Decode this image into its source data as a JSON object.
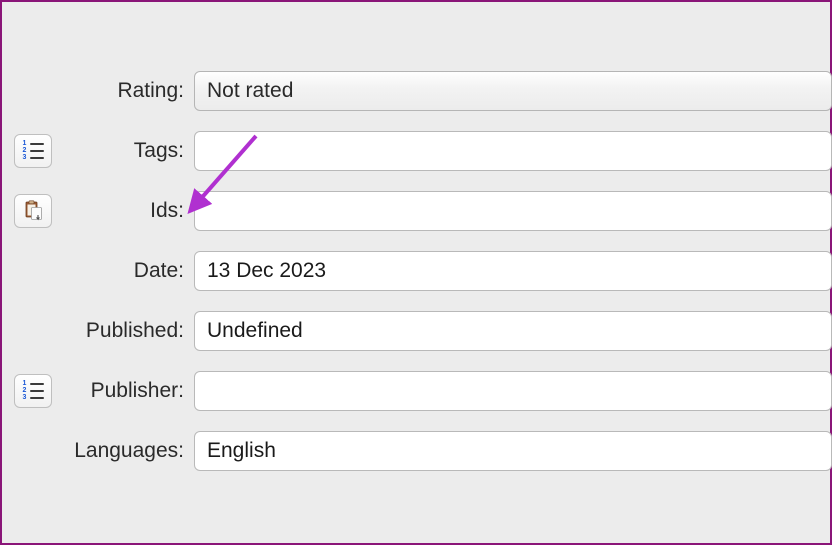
{
  "fields": {
    "rating": {
      "label": "Rating:",
      "value": "Not rated"
    },
    "tags": {
      "label": "Tags:",
      "value": ""
    },
    "ids": {
      "label": "Ids:",
      "value": ""
    },
    "date": {
      "label": "Date:",
      "value": "13 Dec 2023"
    },
    "published": {
      "label": "Published:",
      "value": "Undefined"
    },
    "publisher": {
      "label": "Publisher:",
      "value": ""
    },
    "languages": {
      "label": "Languages:",
      "value": "English"
    }
  },
  "annotation": {
    "arrow_color": "#b030d0"
  }
}
